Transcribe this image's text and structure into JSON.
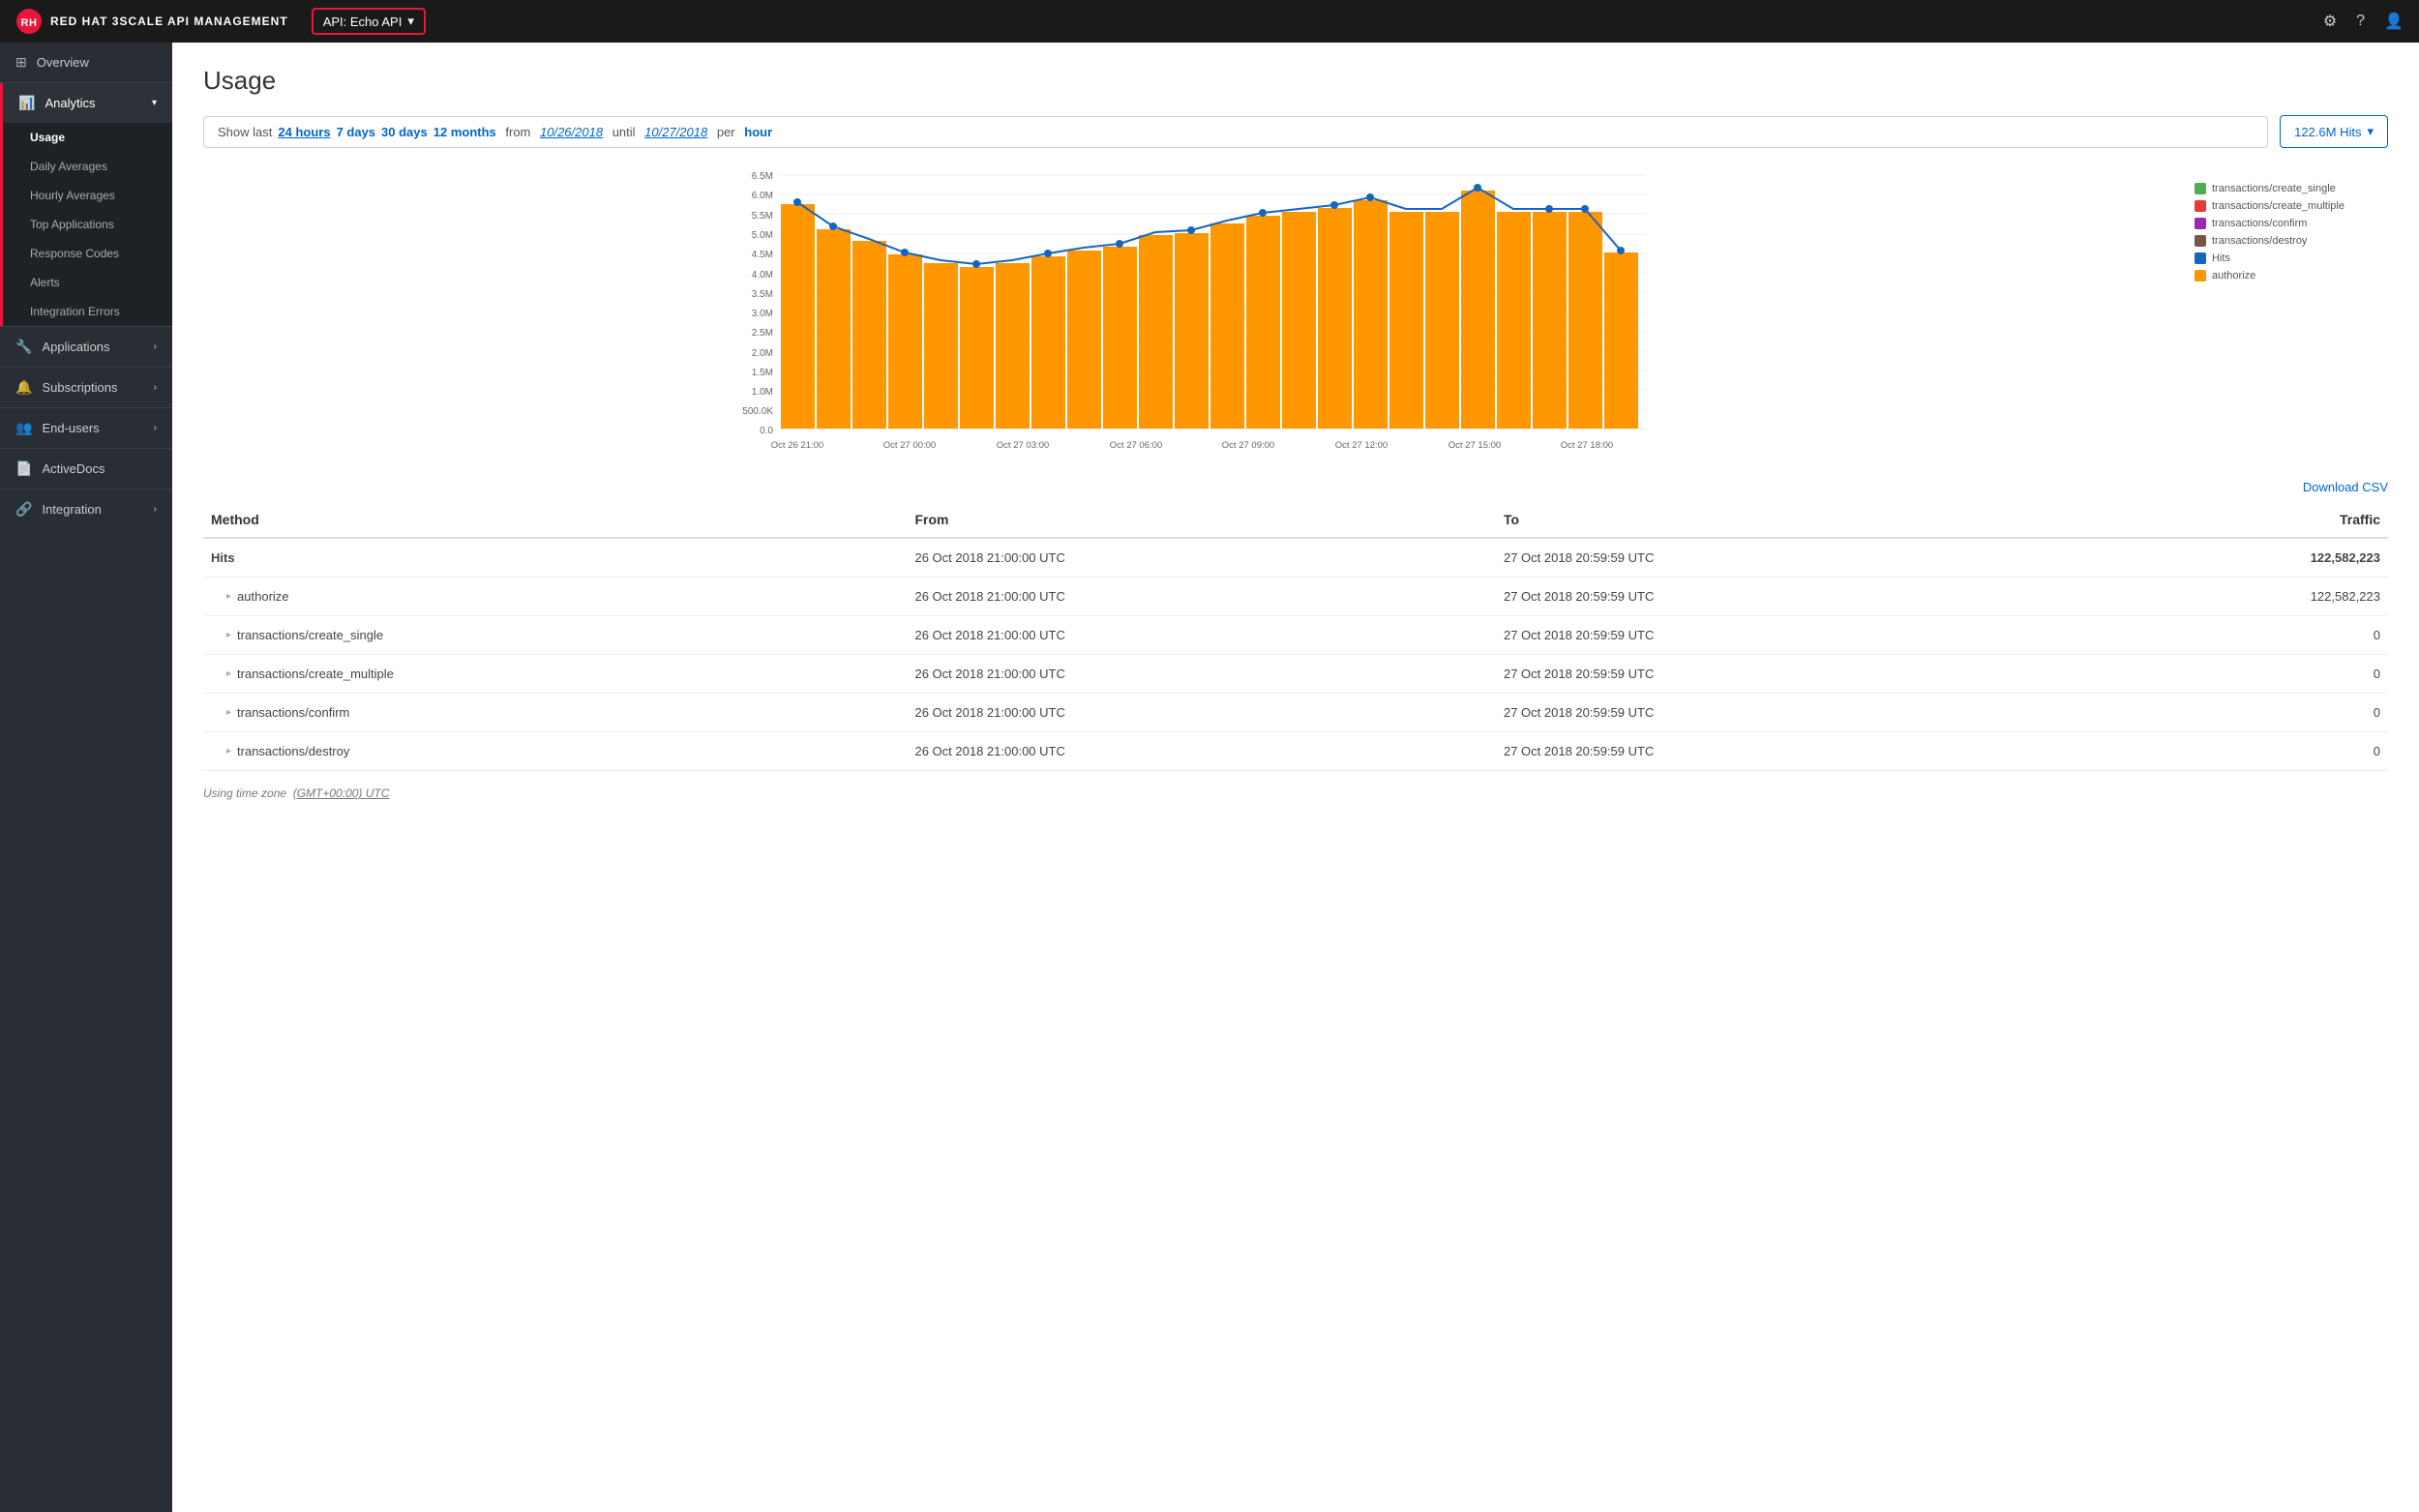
{
  "app": {
    "title": "RED HAT 3SCALE API MANAGEMENT",
    "api_selector": "API: Echo API"
  },
  "topnav": {
    "settings_icon": "⚙",
    "help_icon": "?",
    "user_icon": "👤"
  },
  "sidebar": {
    "overview_label": "Overview",
    "analytics_label": "Analytics",
    "analytics_sub": [
      {
        "label": "Usage",
        "active": true
      },
      {
        "label": "Daily Averages"
      },
      {
        "label": "Hourly Averages"
      },
      {
        "label": "Top Applications"
      },
      {
        "label": "Response Codes"
      },
      {
        "label": "Alerts"
      },
      {
        "label": "Integration Errors"
      }
    ],
    "applications_label": "Applications",
    "subscriptions_label": "Subscriptions",
    "endusers_label": "End-users",
    "activedocs_label": "ActiveDocs",
    "integration_label": "Integration"
  },
  "main": {
    "page_title": "Usage",
    "filter": {
      "show_last_label": "Show last",
      "option_24h": "24 hours",
      "option_7d": "7 days",
      "option_30d": "30 days",
      "option_12m": "12 months",
      "date_range_text": "from",
      "date_from": "10/26/2018",
      "date_until_text": "until",
      "date_to": "10/27/2018",
      "per_text": "per",
      "per_unit": "hour"
    },
    "hits_button": "122.6M Hits",
    "download_csv": "Download CSV",
    "chart": {
      "y_labels": [
        "6.5M",
        "6.0M",
        "5.5M",
        "5.0M",
        "4.5M",
        "4.0M",
        "3.5M",
        "3.0M",
        "2.5M",
        "2.0M",
        "1.5M",
        "1.0M",
        "500.0K",
        "0.0"
      ],
      "x_labels": [
        "Oct 26 21:00",
        "Oct 27 00:00",
        "Oct 27 03:00",
        "Oct 27 06:00",
        "Oct 27 09:00",
        "Oct 27 12:00",
        "Oct 27 15:00",
        "Oct 27 18:00"
      ],
      "bar_values": [
        5.7,
        5.1,
        4.8,
        4.5,
        4.3,
        4.2,
        4.3,
        4.4,
        4.5,
        4.6,
        4.9,
        5.0,
        5.2,
        5.4,
        5.5,
        5.6,
        5.8,
        5.5,
        5.5,
        6.0,
        5.5,
        5.5,
        5.5,
        4.5
      ],
      "line_values": [
        5.75,
        5.1,
        4.82,
        4.52,
        4.35,
        4.25,
        4.3,
        4.42,
        4.55,
        4.65,
        4.92,
        5.02,
        5.22,
        5.42,
        5.52,
        5.62,
        5.82,
        5.5,
        5.5,
        6.0,
        5.5,
        5.5,
        5.48,
        4.5
      ]
    },
    "legend": [
      {
        "label": "transactions/create_single",
        "color": "#4caf50"
      },
      {
        "label": "transactions/create_multiple",
        "color": "#e53935"
      },
      {
        "label": "transactions/confirm",
        "color": "#9c27b0"
      },
      {
        "label": "transactions/destroy",
        "color": "#795548"
      },
      {
        "label": "Hits",
        "color": "#1565c0"
      },
      {
        "label": "authorize",
        "color": "#ff9800"
      }
    ],
    "table": {
      "headers": [
        "Method",
        "From",
        "To",
        "Traffic"
      ],
      "rows": [
        {
          "method": "Hits",
          "from": "26 Oct 2018 21:00:00 UTC",
          "to": "27 Oct 2018 20:59:59 UTC",
          "traffic": "122,582,223",
          "indent": false
        },
        {
          "method": "authorize",
          "from": "26 Oct 2018 21:00:00 UTC",
          "to": "27 Oct 2018 20:59:59 UTC",
          "traffic": "122,582,223",
          "indent": true
        },
        {
          "method": "transactions/create_single",
          "from": "26 Oct 2018 21:00:00 UTC",
          "to": "27 Oct 2018 20:59:59 UTC",
          "traffic": "0",
          "indent": true
        },
        {
          "method": "transactions/create_multiple",
          "from": "26 Oct 2018 21:00:00 UTC",
          "to": "27 Oct 2018 20:59:59 UTC",
          "traffic": "0",
          "indent": true
        },
        {
          "method": "transactions/confirm",
          "from": "26 Oct 2018 21:00:00 UTC",
          "to": "27 Oct 2018 20:59:59 UTC",
          "traffic": "0",
          "indent": true
        },
        {
          "method": "transactions/destroy",
          "from": "26 Oct 2018 21:00:00 UTC",
          "to": "27 Oct 2018 20:59:59 UTC",
          "traffic": "0",
          "indent": true
        }
      ]
    },
    "timezone_label": "Using time zone",
    "timezone_value": "(GMT+00:00) UTC"
  }
}
